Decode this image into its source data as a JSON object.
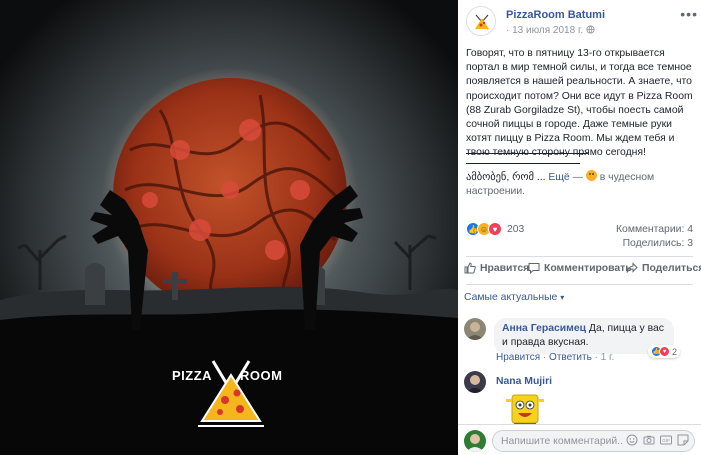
{
  "photo": {
    "logo_left": "PIZZA",
    "logo_right": "ROOM",
    "bg_color": "#000000",
    "moon_color": "#c85a1e"
  },
  "post": {
    "page_name": "PizzaRoom Batumi",
    "date": "13 июля 2018 г.",
    "meta_separator": "·",
    "globe_icon": "globe-icon",
    "more_icon": "•••",
    "text": "Говорят, что в пятницу 13-го открывается портал в мир темной силы, и тогда все темное появляется в нашей реальности. А знаете, что происходит потом? Они все идут в Pizza Room (88 Zurab Gorgiladze St), чтобы поесть самой сочной пиццы в городе. Даже темные руки хотят пиццу в Pizza Room. Мы ждем тебя и твою темную сторону прямо сегодня!",
    "georgian_text": "ამბობენ, რომ ...",
    "see_more": "Ещё",
    "dash": "—",
    "mood": "в чудесном настроении."
  },
  "reactions": {
    "count": "203",
    "comments": "Комментарии: 4",
    "shares": "Поделились: 3"
  },
  "actions": {
    "like": "Нравится",
    "comment": "Комментировать",
    "share": "Поделиться"
  },
  "sort": {
    "label": "Самые актуальные",
    "caret": "▾"
  },
  "comments": [
    {
      "author": "Анна Герасимец",
      "text": "Да, пицца у вас и правда вкусная.",
      "like": "Нравится",
      "reply": "Ответить",
      "time": "1 г.",
      "sep": "·",
      "reaction_count": "2"
    },
    {
      "author": "Nana Mujiri"
    }
  ],
  "composer": {
    "placeholder": "Напишите комментарий..."
  },
  "colors": {
    "link": "#385898",
    "like": "#1877f2",
    "love": "#f33e58",
    "haha": "#f7b125"
  }
}
